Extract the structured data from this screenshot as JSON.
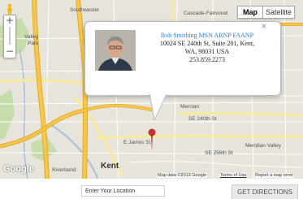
{
  "map_type": {
    "map_label": "Map",
    "satellite_label": "Satellite",
    "selected": "Map"
  },
  "zoom": {
    "in_symbol": "+",
    "out_symbol": "−"
  },
  "place_labels": {
    "southwester": "Southwester",
    "cascade_fairwood": "Cascade-Fairwood",
    "valley": "Valley",
    "park": "Park",
    "mercian": "Mercian",
    "meridian_valley": "Meridian Valley",
    "kent": "Kent",
    "riverbend": "Riverbend",
    "james_st": "E James St",
    "se_240th": "SE 240th St",
    "se_256th": "SE 256th St"
  },
  "info_window": {
    "name": "Bob Smithing MSN ARNP FAANP",
    "address_line1": "10024 SE 240th St, Suite 201, Kent,",
    "address_line2": "WA, 98031 USA",
    "phone": "253.859.2273",
    "close_symbol": "×"
  },
  "attribution": {
    "map_data": "Map data ©2013 Google",
    "terms": "Terms of Use",
    "report": "Report a map error"
  },
  "google_logo_text": "Google",
  "directions_form": {
    "location_placeholder": "Enter Your Location",
    "button_label": "GET DIRECTIONS"
  },
  "colors": {
    "map_background": "#e7e4dc",
    "highway": "#f7c74a",
    "highway_outline": "#e3a72b",
    "arterial": "#ffffff",
    "water": "#a5bfdd",
    "park": "#c8dbaa",
    "pin": "#c9322b",
    "link": "#2f7fc6"
  }
}
